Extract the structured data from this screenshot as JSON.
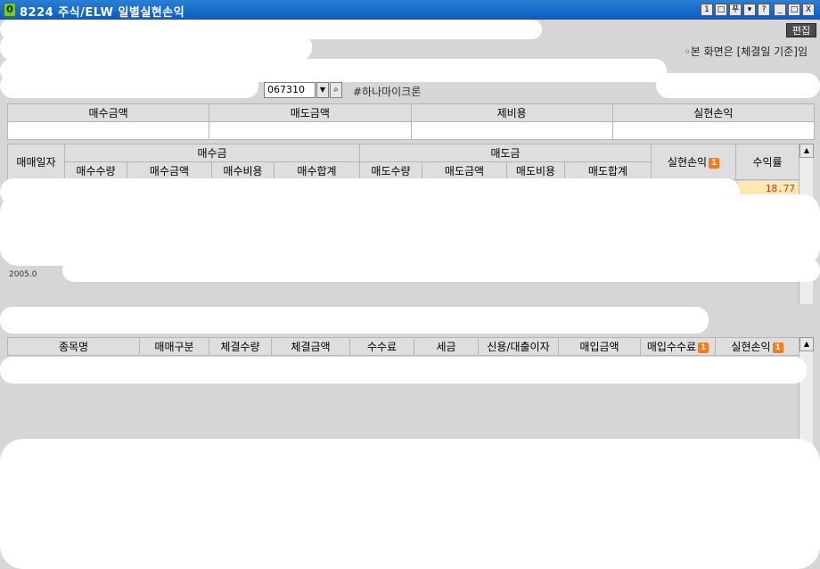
{
  "window": {
    "badge": "0",
    "title": "8224 주식/ELW 일별실현손익",
    "buttons": [
      "1",
      "□",
      "푸",
      "▾",
      "?",
      "_",
      "□",
      "X"
    ]
  },
  "toolbar": {
    "edit_label": "편집",
    "notice": "◦본 화면은 [체결일 기준]임"
  },
  "search": {
    "code": "067310",
    "stock_name": "#하나마이크론"
  },
  "summary": {
    "headers": [
      "매수금액",
      "매도금액",
      "제비용",
      "실현손익"
    ]
  },
  "daily_grid": {
    "date_header": "매매일자",
    "buy_group": "매수금",
    "sell_group": "매도금",
    "realized_header": "실현손익",
    "rate_header": "수익률",
    "buy_cols": [
      "매수수량",
      "매수금액",
      "매수비용",
      "매수합계"
    ],
    "sell_cols": [
      "매도수량",
      "매도금액",
      "매도비용",
      "매도합계"
    ],
    "first_row_rate": "18.77",
    "date_stub": "2005.0"
  },
  "detail_grid": {
    "headers": [
      "종목명",
      "매매구분",
      "체결수량",
      "체결금액",
      "수수료",
      "세금",
      "신용/대출이자",
      "매입금액",
      "매입수수료",
      "실현손익"
    ]
  },
  "badge_text": "1",
  "colors": {
    "title_bar": "#0a5cc0",
    "background": "#d6d6d6",
    "badge": "#f07c1c",
    "rate_text": "#c0392b",
    "rate_highlight": "#fde8b0"
  }
}
